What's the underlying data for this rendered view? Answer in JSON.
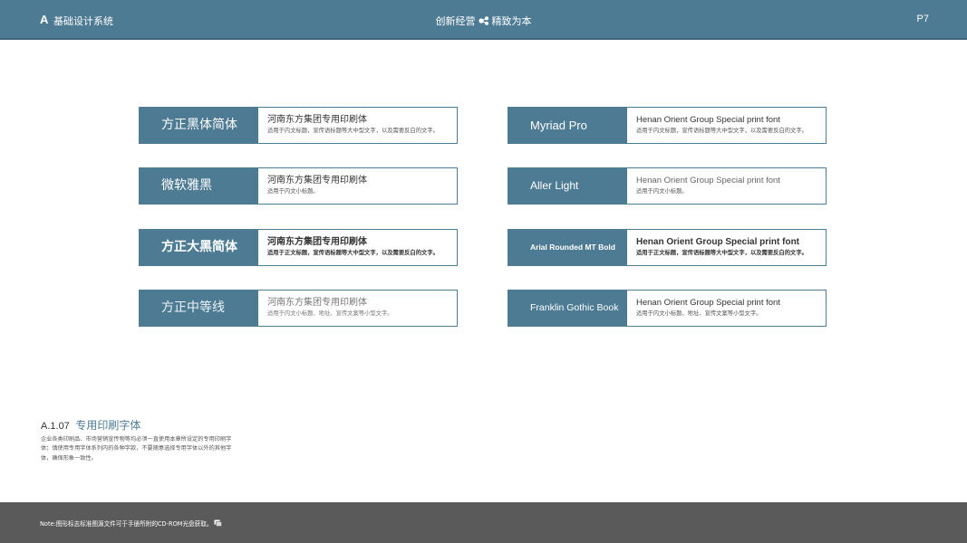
{
  "header": {
    "logo_mark": "A",
    "system_title": "基础设计系统",
    "slogan_left": "创新经营",
    "slogan_right": "精致为本",
    "slogan_icon": "molecule-icon",
    "page_number": "P7"
  },
  "fonts": [
    {
      "name": "方正黑体简体",
      "line1": "河南东方集团专用印刷体",
      "line2": "适用于内文标题，宣传语标题等大中型文字，以及需要反白的文字。"
    },
    {
      "name": "微软雅黑",
      "line1": "河南东方集团专用印刷体",
      "line2": "适用于内文小标题。"
    },
    {
      "name": "方正大黑简体",
      "line1": "河南东方集团专用印刷体",
      "line2": "适用于正文标题，宣传语标题等大中型文字，以及需要反白的文字。"
    },
    {
      "name": "方正中等线",
      "line1": "河南东方集团专用印刷体",
      "line2": "适用于内文小标题、地址、宣传文案等小型文字。"
    },
    {
      "name": "Myriad Pro",
      "line1": "Henan Orient Group Special print font",
      "line2": "适用于内文标题，宣传语标题等大中型文字，以及需要反白的文字。"
    },
    {
      "name": "Aller Light",
      "line1": "Henan Orient Group Special print font",
      "line2": "适用于内文小标题。"
    },
    {
      "name": "Arial Rounded MT Bold",
      "line1": "Henan Orient Group Special print font",
      "line2": "适用于正文标题，宣传语标题等大中型文字，以及需要反白的文字。"
    },
    {
      "name": "Franklin Gothic Book",
      "line1": "Henan Orient Group Special print font",
      "line2": "适用于内文小标题、地址、宣传文案等小型文字。"
    }
  ],
  "section": {
    "code": "A.1.07",
    "title": "专用印刷字体",
    "body": "企业各类印刷品、市场营销宣传物等均必须一直使用本章所设定的专用印刷字体；慎使用专用字体系列内的各种字款，不要随意选择专用字体以外的其他字体，确保形象一致性。"
  },
  "footer": {
    "note": "Note:图形标志标准图源文件可于手册所附的CD-ROM光盘获取。",
    "note_icon": "cd-icon"
  },
  "colors": {
    "brand_blue": "#4d7b93",
    "footer_gray": "#5b5a5b"
  }
}
